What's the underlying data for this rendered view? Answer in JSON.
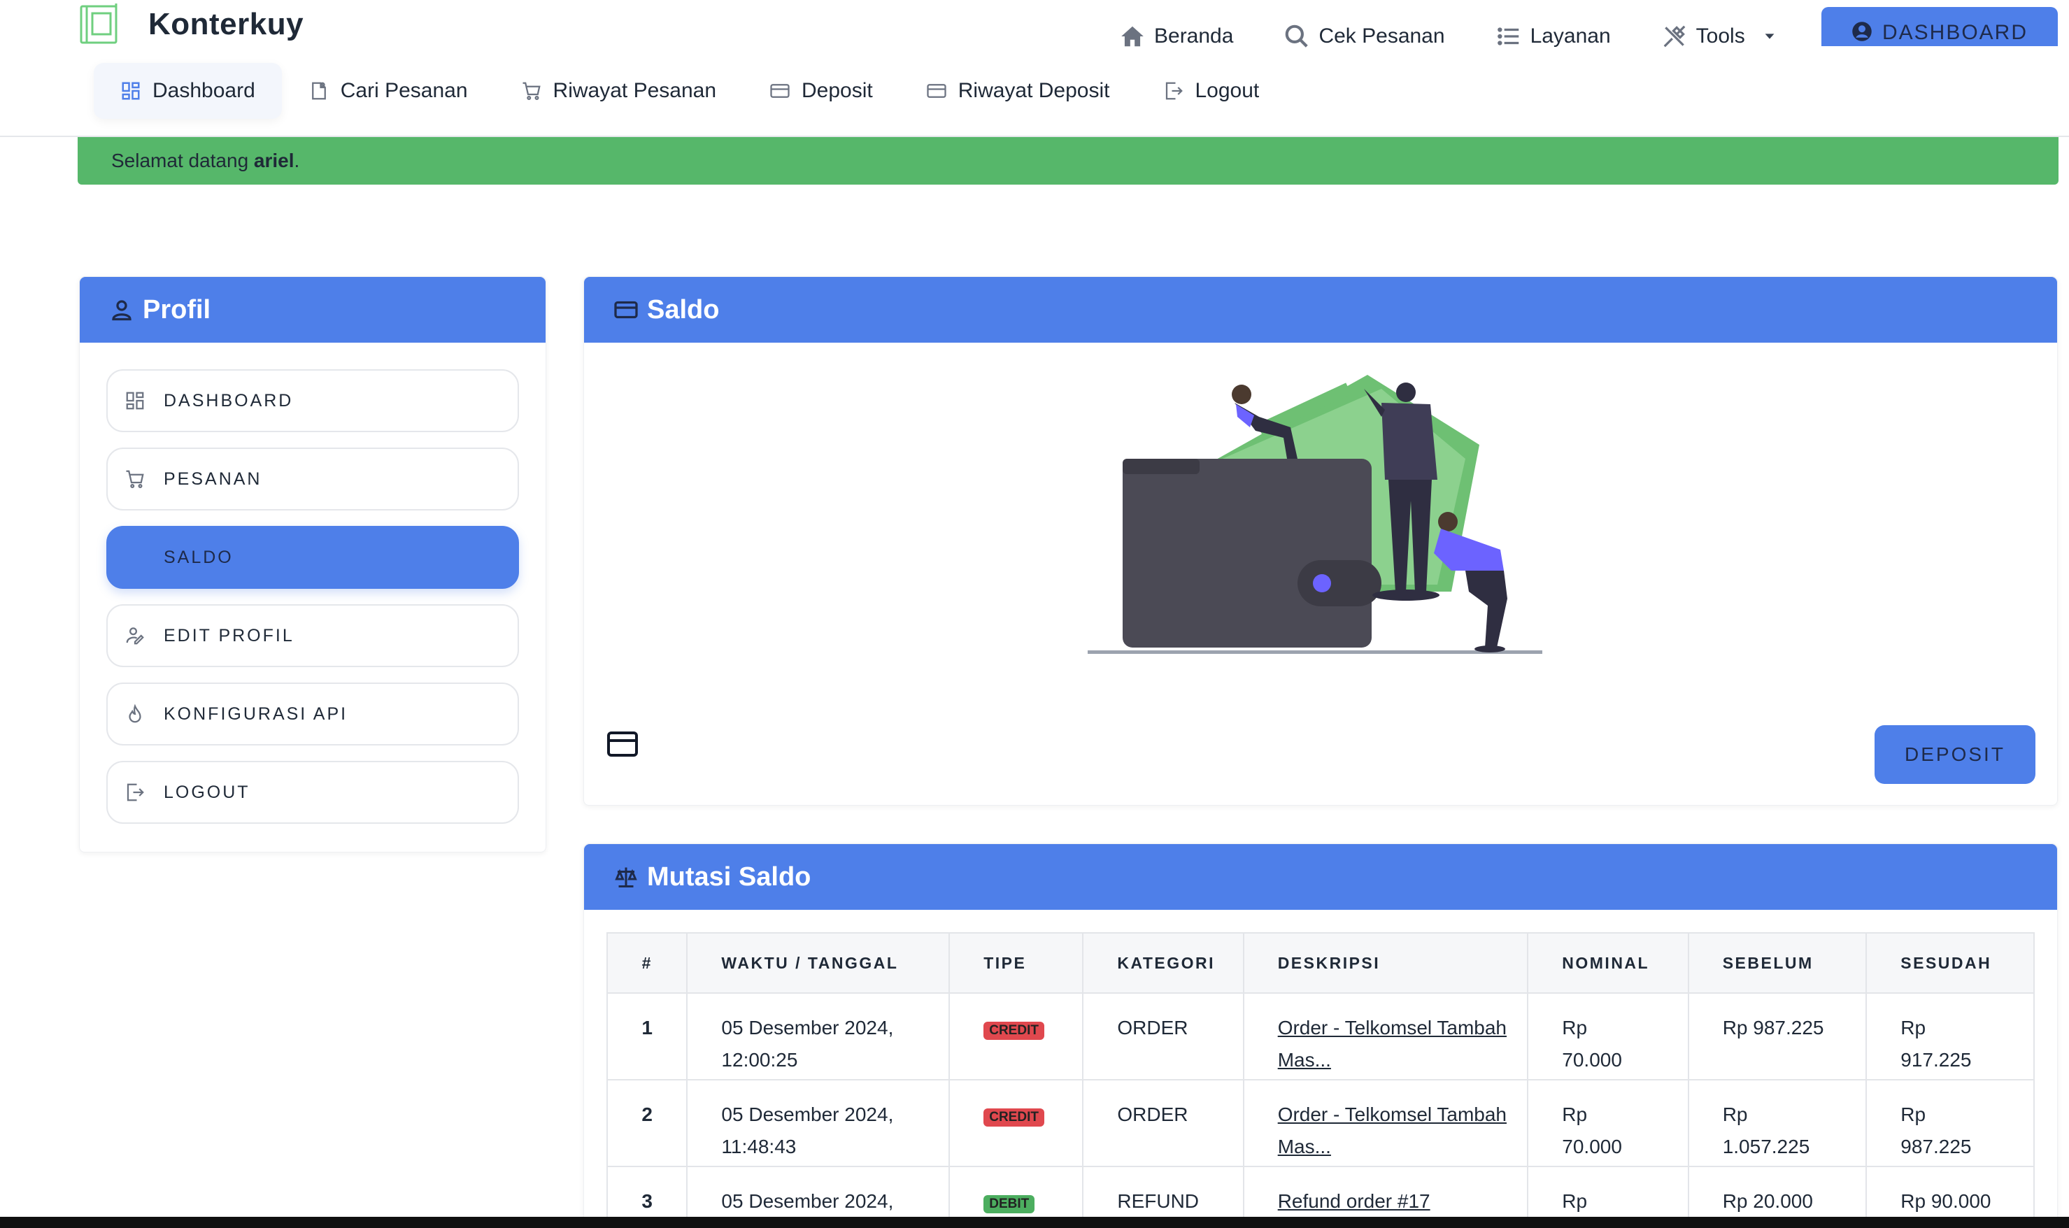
{
  "brand": {
    "name": "Konterkuy",
    "accent": "#4e7fe9",
    "success": "#56b76a"
  },
  "topnav": {
    "items": [
      {
        "label": "Beranda",
        "icon": "home-icon"
      },
      {
        "label": "Cek Pesanan",
        "icon": "search-icon"
      },
      {
        "label": "Layanan",
        "icon": "list-icon"
      },
      {
        "label": "Tools",
        "icon": "tools-icon"
      }
    ],
    "dashboard_button": "DASHBOARD"
  },
  "subnav": {
    "items": [
      {
        "label": "Dashboard",
        "icon": "grid-icon",
        "active": true
      },
      {
        "label": "Cari Pesanan",
        "icon": "document-search-icon"
      },
      {
        "label": "Riwayat Pesanan",
        "icon": "cart-icon"
      },
      {
        "label": "Deposit",
        "icon": "credit-card-icon"
      },
      {
        "label": "Riwayat Deposit",
        "icon": "credit-card-icon"
      },
      {
        "label": "Logout",
        "icon": "logout-icon"
      }
    ]
  },
  "alert": {
    "prefix": "Selamat datang ",
    "user": "ariel",
    "suffix": "."
  },
  "profile": {
    "title": "Profil",
    "menu": [
      {
        "label": "DASHBOARD",
        "icon": "grid-icon"
      },
      {
        "label": "PESANAN",
        "icon": "cart-icon"
      },
      {
        "label": "SALDO",
        "icon": "",
        "active": true
      },
      {
        "label": "EDIT PROFIL",
        "icon": "user-edit-icon"
      },
      {
        "label": "KONFIGURASI API",
        "icon": "flame-icon"
      },
      {
        "label": "LOGOUT",
        "icon": "logout-icon"
      }
    ]
  },
  "saldo": {
    "title": "Saldo",
    "deposit_button": "DEPOSIT"
  },
  "mutasi": {
    "title": "Mutasi Saldo",
    "columns": [
      "#",
      "WAKTU / TANGGAL",
      "TIPE",
      "KATEGORI",
      "DESKRIPSI",
      "NOMINAL",
      "SEBELUM",
      "SESUDAH"
    ],
    "rows": [
      {
        "no": "1",
        "time": "05 Desember 2024, 12:00:25",
        "type": "CREDIT",
        "category": "ORDER",
        "desc": "Order - Telkomsel Tambah Mas...",
        "nominal": "Rp 70.000",
        "before": "Rp 987.225",
        "after": "Rp 917.225"
      },
      {
        "no": "2",
        "time": "05 Desember 2024, 11:48:43",
        "type": "CREDIT",
        "category": "ORDER",
        "desc": "Order - Telkomsel Tambah Mas...",
        "nominal": "Rp 70.000",
        "before": "Rp 1.057.225",
        "after": "Rp 987.225"
      },
      {
        "no": "3",
        "time": "05 Desember 2024,",
        "type": "DEBIT",
        "category": "REFUND",
        "desc": "Refund order #17",
        "nominal": "Rp",
        "before": "Rp 20.000",
        "after": "Rp 90.000"
      }
    ]
  }
}
